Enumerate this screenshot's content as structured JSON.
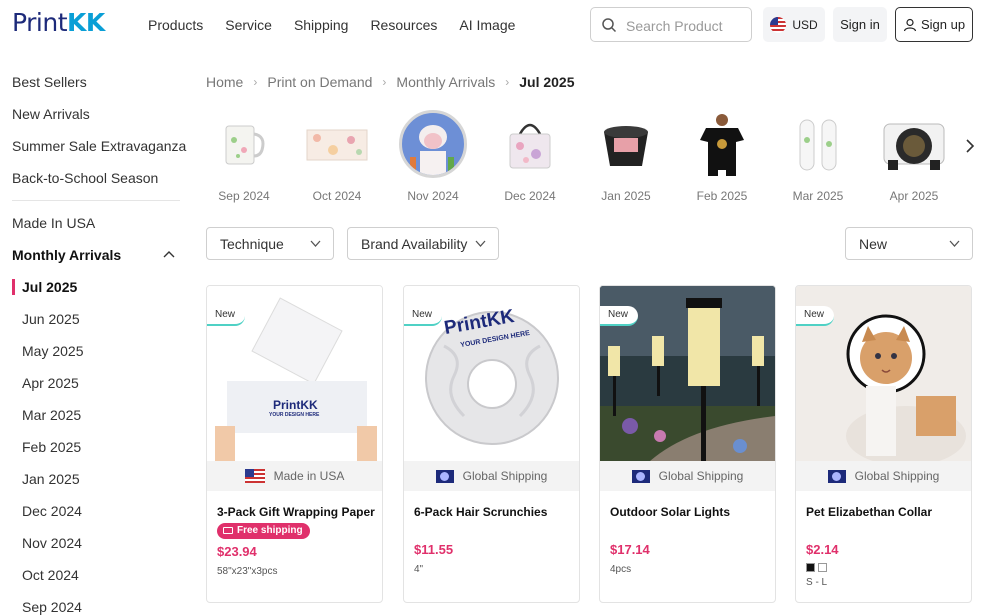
{
  "header": {
    "logo_print": "Print",
    "logo_kk": "KK",
    "nav": [
      "Products",
      "Service",
      "Shipping",
      "Resources",
      "AI Image"
    ],
    "search_placeholder": "Search Product",
    "currency": "USD",
    "signin": "Sign in",
    "signup": "Sign up"
  },
  "sidebar": {
    "links": [
      "Best Sellers",
      "New Arrivals",
      "Summer Sale Extravaganza",
      "Back-to-School Season"
    ],
    "made_in_usa": "Made In USA",
    "monthly_title": "Monthly Arrivals",
    "months": [
      "Jul 2025",
      "Jun 2025",
      "May 2025",
      "Apr 2025",
      "Mar 2025",
      "Feb 2025",
      "Jan 2025",
      "Dec 2024",
      "Nov 2024",
      "Oct 2024",
      "Sep 2024"
    ],
    "active_month": "Jul 2025"
  },
  "breadcrumb": [
    "Home",
    "Print on Demand",
    "Monthly Arrivals",
    "Jul 2025"
  ],
  "month_carousel": [
    {
      "label": "Sep 2024",
      "icon": "glass-mug"
    },
    {
      "label": "Oct 2024",
      "icon": "floral-mat"
    },
    {
      "label": "Nov 2024",
      "icon": "sheep-painting"
    },
    {
      "label": "Dec 2024",
      "icon": "floral-handbag"
    },
    {
      "label": "Jan 2025",
      "icon": "black-tumbler"
    },
    {
      "label": "Feb 2025",
      "icon": "black-tshirt"
    },
    {
      "label": "Mar 2025",
      "icon": "white-sneakers"
    },
    {
      "label": "Apr 2025",
      "icon": "tire-cover"
    }
  ],
  "filters": {
    "technique": "Technique",
    "brand": "Brand Availability",
    "sort": "New"
  },
  "products": [
    {
      "badge": "New",
      "ship": "Made in USA",
      "ship_type": "usa",
      "title": "3-Pack Gift Wrapping Paper",
      "free_shipping": "Free shipping",
      "price": "$23.94",
      "spec": "58\"x23\"x3pcs"
    },
    {
      "badge": "New",
      "ship": "Global Shipping",
      "ship_type": "global",
      "title": "6-Pack Hair Scrunchies",
      "price": "$11.55",
      "spec": "4\""
    },
    {
      "badge": "New",
      "ship": "Global Shipping",
      "ship_type": "global",
      "title": "Outdoor Solar Lights",
      "price": "$17.14",
      "spec": "4pcs"
    },
    {
      "badge": "New",
      "ship": "Global Shipping",
      "ship_type": "global",
      "title": "Pet Elizabethan Collar",
      "price": "$2.14",
      "spec": "S - L",
      "swatches": [
        "#111111",
        "#ffffff"
      ]
    }
  ],
  "brand_text": {
    "logo": "PrintKK",
    "sub": "YOUR DESIGN HERE"
  }
}
